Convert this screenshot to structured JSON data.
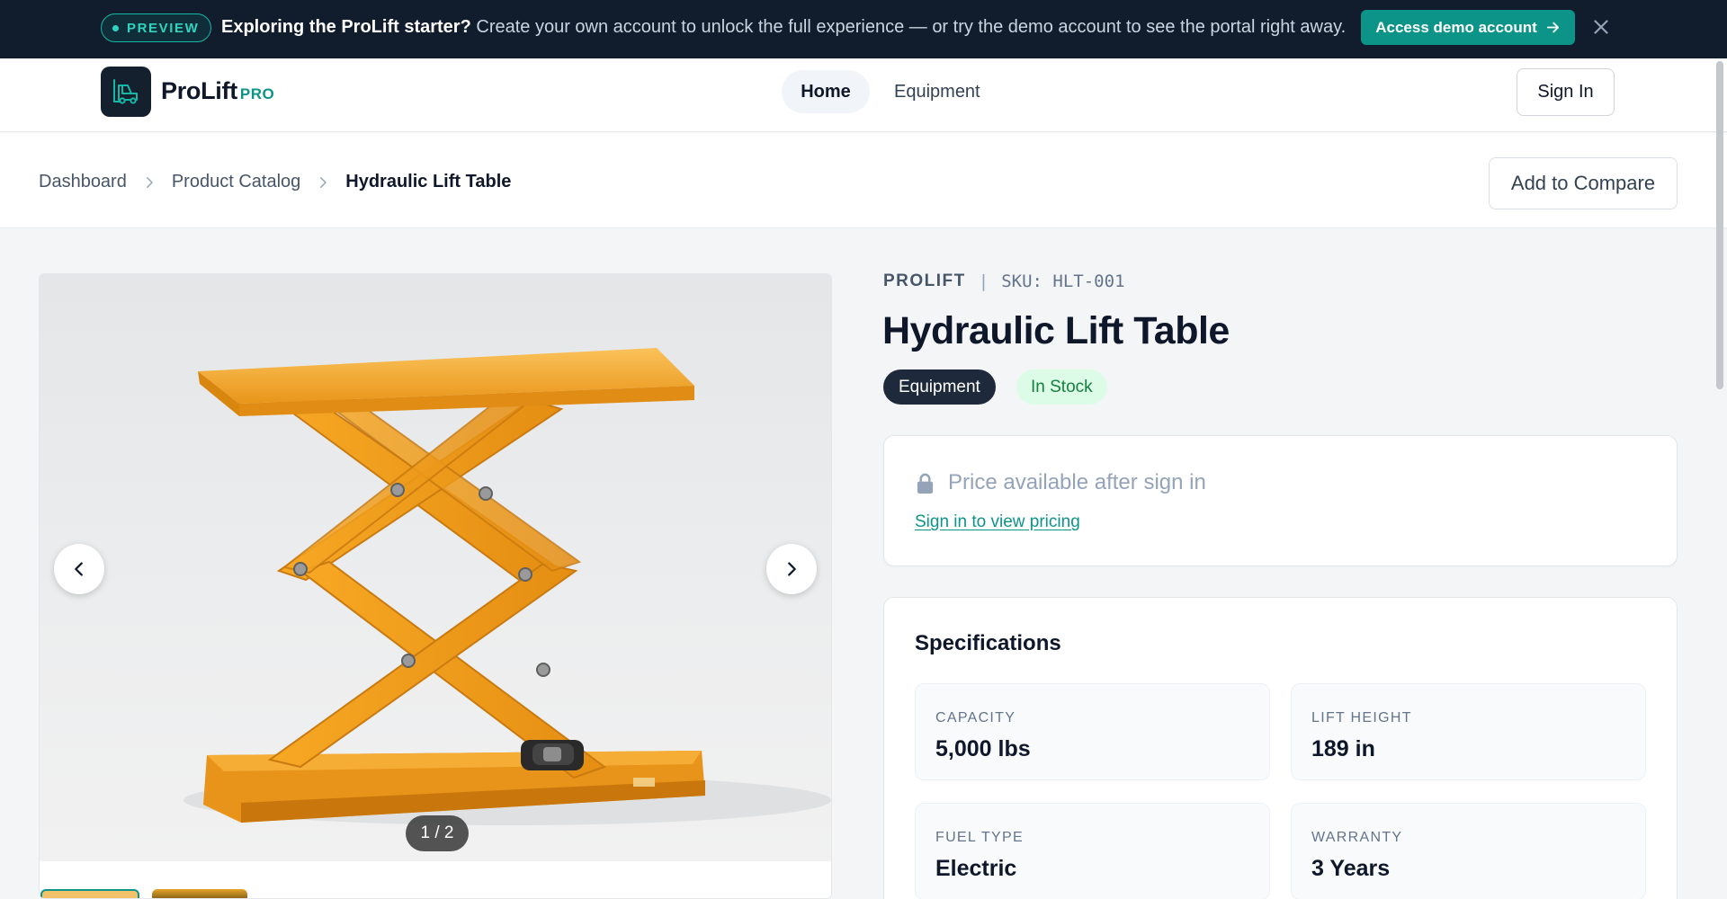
{
  "banner": {
    "pill_label": "PREVIEW",
    "headline": "Exploring the ProLift starter?",
    "message": " Create your own account to unlock the full experience — or try the demo account to see the portal right away.",
    "cta_label": "Access demo account",
    "accent": "#0d9488"
  },
  "header": {
    "brand": "ProLift",
    "brand_suffix": "PRO",
    "nav": {
      "home": "Home",
      "equipment": "Equipment"
    },
    "signin_label": "Sign In"
  },
  "breadcrumb": {
    "items": [
      "Dashboard",
      "Product Catalog",
      "Hydraulic Lift Table"
    ],
    "compare_label": "Add to Compare"
  },
  "gallery": {
    "counter": "1 / 2",
    "image_count": 2,
    "current_index": 1
  },
  "product": {
    "brand": "PROLIFT",
    "sku": "SKU: HLT-001",
    "title": "Hydraulic Lift Table",
    "category": "Equipment",
    "stock": "In Stock",
    "price_locked": "Price available after sign in",
    "price_link": "Sign in to view pricing"
  },
  "specs": {
    "title": "Specifications",
    "items": [
      {
        "label": "CAPACITY",
        "value": "5,000 lbs"
      },
      {
        "label": "LIFT HEIGHT",
        "value": "189 in"
      },
      {
        "label": "FUEL TYPE",
        "value": "Electric"
      },
      {
        "label": "WARRANTY",
        "value": "3 Years"
      }
    ]
  },
  "icons": [
    "close-icon",
    "arrow-right-icon",
    "forklift-icon",
    "chevron-right-icon",
    "chevron-left-icon",
    "lock-icon"
  ]
}
